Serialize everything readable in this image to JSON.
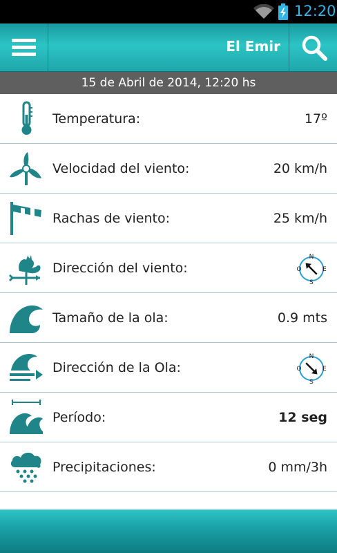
{
  "status_bar": {
    "time": "12:20",
    "icons": [
      "wifi-icon",
      "battery-charging-icon"
    ]
  },
  "app_bar": {
    "title": "El Emir",
    "menu_icon": "hamburger-menu-icon",
    "search_icon": "search-icon"
  },
  "date_line": "15 de Abril de 2014, 12:20 hs",
  "colors": {
    "accent": "#1a9aa0",
    "icon": "#1f8588",
    "divider": "#a9c7cc",
    "date_bar": "#5f5f5f"
  },
  "rows": [
    {
      "icon": "thermometer-icon",
      "label": "Temperatura:",
      "value": "17º"
    },
    {
      "icon": "wind-turbine-icon",
      "label": "Velocidad del viento:",
      "value": "20 km/h"
    },
    {
      "icon": "windsock-icon",
      "label": "Rachas de viento:",
      "value": "25 km/h"
    },
    {
      "icon": "weathervane-rooster-icon",
      "label": "Dirección del viento:",
      "value_icon": "compass-icon",
      "compass": {
        "n": "N",
        "e": "E",
        "s": "S",
        "o": "O",
        "arrow_deg": 135
      }
    },
    {
      "icon": "wave-icon",
      "label": "Tamaño de la ola:",
      "value": "0.9 mts"
    },
    {
      "icon": "wave-direction-icon",
      "label": "Dirección de la Ola:",
      "value_icon": "compass-icon",
      "compass": {
        "n": "N",
        "e": "E",
        "s": "S",
        "o": "O",
        "arrow_deg": -45
      }
    },
    {
      "icon": "wave-period-icon",
      "label": "Período:",
      "value": "12 seg"
    },
    {
      "icon": "rain-cloud-icon",
      "label": "Precipitaciones:",
      "value": "0 mm/3h"
    }
  ]
}
